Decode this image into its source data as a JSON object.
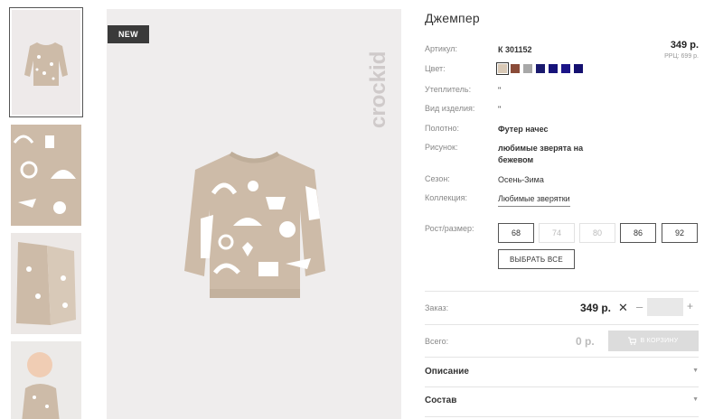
{
  "badge": "NEW",
  "brand": "crockid",
  "thumbnails": [
    {
      "name": "thumb-front",
      "active": true
    },
    {
      "name": "thumb-pattern",
      "active": false
    },
    {
      "name": "thumb-inside",
      "active": false
    },
    {
      "name": "thumb-model",
      "active": false
    }
  ],
  "product": {
    "title": "Джемпер",
    "article_label": "Артикул:",
    "article_value": "К 301152",
    "price": "349 р.",
    "rrc": "РРЦ: 699 р.",
    "color_label": "Цвет:",
    "colors": [
      "#d9c9b6",
      "#8a4b38",
      "#a8a8a8",
      "#1a1a6e",
      "#16137a",
      "#1b1488",
      "#141070"
    ],
    "insulation_label": "Утеплитель:",
    "insulation_value": "\"",
    "type_label": "Вид изделия:",
    "type_value": "\"",
    "fabric_label": "Полотно:",
    "fabric_value": "Футер начес",
    "pattern_label": "Рисунок:",
    "pattern_value_line1": "любимые зверята на",
    "pattern_value_line2": "бежевом",
    "season_label": "Сезон:",
    "season_value": "Осень-Зима",
    "collection_label": "Коллекция:",
    "collection_value": "Любимые зверятки",
    "size_label": "Рост/размер:",
    "sizes": [
      {
        "label": "68",
        "available": true
      },
      {
        "label": "74",
        "available": false
      },
      {
        "label": "80",
        "available": false
      },
      {
        "label": "86",
        "available": true
      },
      {
        "label": "92",
        "available": true
      }
    ],
    "select_all": "ВЫБРАТЬ ВСЕ"
  },
  "order": {
    "label": "Заказ:",
    "price": "349 р.",
    "times": "✕",
    "minus": "–",
    "plus": "+",
    "qty": ""
  },
  "total": {
    "label": "Всего:",
    "value": "0 р.",
    "cart_button": "В КОРЗИНУ"
  },
  "accordion": [
    {
      "label": "Описание"
    },
    {
      "label": "Состав"
    }
  ],
  "icons": {
    "cart": "cart-icon",
    "chevron": "chevron-down-icon"
  }
}
